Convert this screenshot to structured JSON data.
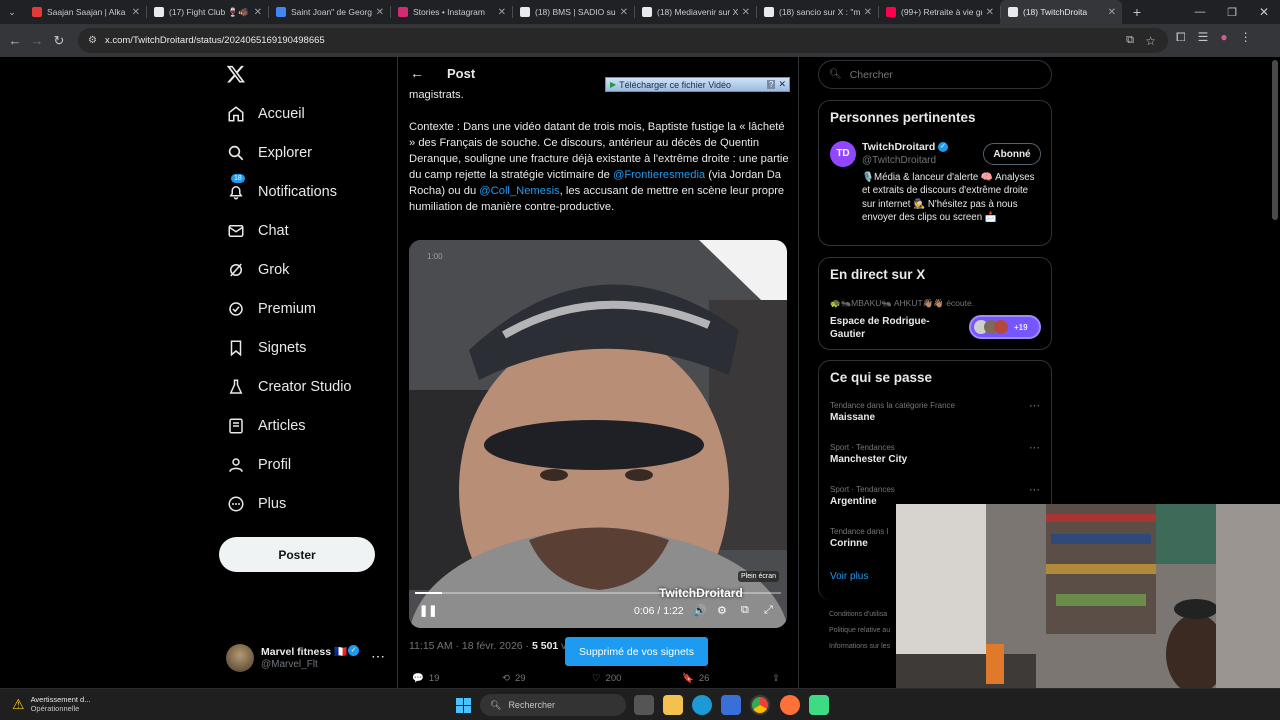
{
  "browser": {
    "tabs": [
      {
        "title": "Saajan Saajan | Alka Y",
        "color": "#e53935",
        "active": false
      },
      {
        "title": "(17) Fight Club 🍷🐗",
        "color": "#e7e9ea",
        "active": false
      },
      {
        "title": "Saint Joan\" de George",
        "color": "#4285f4",
        "active": false
      },
      {
        "title": "Stories • Instagram",
        "color": "#d62976",
        "active": false
      },
      {
        "title": "(18) BMS | SADIO sur",
        "color": "#e7e9ea",
        "active": false
      },
      {
        "title": "(18) Mediavenir sur X",
        "color": "#e7e9ea",
        "active": false
      },
      {
        "title": "(18) sancio sur X : \"m",
        "color": "#e7e9ea",
        "active": false
      },
      {
        "title": "(99+) Retraite à vie gr",
        "color": "#ff0050",
        "active": false
      },
      {
        "title": "(18) TwitchDroita",
        "color": "#e7e9ea",
        "active": true
      }
    ],
    "url": "x.com/TwitchDroitard/status/2024065169190498665"
  },
  "nav": {
    "items": [
      {
        "label": "Accueil",
        "icon": "home-icon"
      },
      {
        "label": "Explorer",
        "icon": "search-icon"
      },
      {
        "label": "Notifications",
        "icon": "bell-icon",
        "badge": "18"
      },
      {
        "label": "Chat",
        "icon": "mail-icon"
      },
      {
        "label": "Grok",
        "icon": "grok-icon"
      },
      {
        "label": "Premium",
        "icon": "premium-icon"
      },
      {
        "label": "Signets",
        "icon": "bookmark-icon"
      },
      {
        "label": "Creator Studio",
        "icon": "flask-icon"
      },
      {
        "label": "Articles",
        "icon": "article-icon"
      },
      {
        "label": "Profil",
        "icon": "person-icon"
      },
      {
        "label": "Plus",
        "icon": "more-circle-icon"
      }
    ],
    "post_button": "Poster",
    "account": {
      "name": "Marvel fitness 🇫🇷",
      "handle": "@Marvel_Flt"
    }
  },
  "post": {
    "header": "Post",
    "download_bar": "Télécharger ce fichier Vidéo",
    "download_help": "?",
    "text_top": "magistrats.",
    "text_1": "Contexte : Dans une vidéo datant de trois mois, Baptiste fustige la « lâcheté » des Français de souche. Ce discours, antérieur au décès de Quentin Deranque, souligne une fracture déjà existante à l'extrême droite : une partie du camp rejette la stratégie victimaire de",
    "mention_1": "@Frontieresmedia",
    "text_2": " (via Jordan Da Rocha) ou du ",
    "mention_2": "@Coll_Nemesis",
    "text_3": ", les accusant de mettre en scène leur propre humiliation de manière contre-productive.",
    "video": {
      "watermark_small": "1:00",
      "watermark": "TwitchDroitard",
      "fullscreen_tip": "Plein écran",
      "time": "0:06 / 1:22",
      "progress": 0.073
    },
    "meta": "11:15 AM · 18 févr. 2026 · ",
    "views": "5 501",
    "views_label": " vue",
    "toast": "Supprimé de vos signets",
    "actions": {
      "replies": "19",
      "reposts": "29",
      "likes": "200",
      "bookmarks": "26"
    }
  },
  "right": {
    "search_placeholder": "Chercher",
    "relevant": {
      "title": "Personnes pertinentes",
      "name": "TwitchDroitard",
      "handle": "@TwitchDroitard",
      "follow": "Abonné",
      "bio": "🎙️Média & lanceur d'alerte 🧠 Analyses et extraits de discours d'extrême droite sur internet 🕵️ N'hésitez pas à nous envoyer des clips ou screen 📩"
    },
    "live": {
      "title": "En direct sur X",
      "hosts": "🐢🐜MBAKU🐜 AHKUT👋🏽👋🏽 écoute.",
      "space": "Espace de Rodrigue-Gautier",
      "count": "+19"
    },
    "trends": {
      "title": "Ce qui se passe",
      "items": [
        {
          "meta": "Tendance dans la catégorie France",
          "name": "Maissane"
        },
        {
          "meta": "Sport · Tendances",
          "name": "Manchester City"
        },
        {
          "meta": "Sport · Tendances",
          "name": "Argentine"
        },
        {
          "meta": "Tendance dans l",
          "name": "Corinne"
        }
      ],
      "more": "Voir plus"
    },
    "footer": [
      "Conditions d'utilisa",
      "Politique relative au",
      "Informations sur les"
    ]
  },
  "taskbar": {
    "alert_title": "Avertissement d...",
    "alert_sub": "Opérationnelle",
    "search": "Rechercher"
  }
}
